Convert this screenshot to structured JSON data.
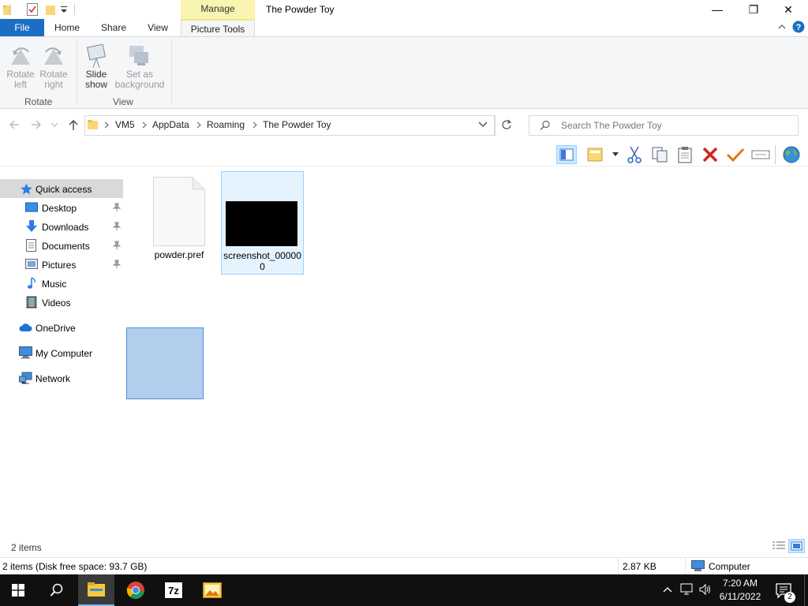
{
  "window": {
    "title": "The Powder Toy",
    "context_tab_group": "Manage",
    "controls": {
      "minimize": "—",
      "maximize": "❐",
      "close": "✕"
    }
  },
  "tabs": [
    "File",
    "Home",
    "Share",
    "View",
    "Picture Tools"
  ],
  "ribbon": {
    "rotate_left": [
      "Rotate",
      "left"
    ],
    "rotate_right": [
      "Rotate",
      "right"
    ],
    "slide_show": [
      "Slide",
      "show"
    ],
    "set_bg": [
      "Set as",
      "background"
    ],
    "group_rotate": "Rotate",
    "group_view": "View"
  },
  "address": {
    "crumbs": [
      "VM5",
      "AppData",
      "Roaming",
      "The Powder Toy"
    ],
    "search_placeholder": "Search The Powder Toy"
  },
  "nav": {
    "quick_access": "Quick access",
    "items": [
      "Desktop",
      "Downloads",
      "Documents",
      "Pictures",
      "Music",
      "Videos"
    ],
    "onedrive": "OneDrive",
    "my_computer": "My Computer",
    "network": "Network"
  },
  "files": [
    {
      "name": "powder.pref",
      "type": "file"
    },
    {
      "name": "screenshot_00000",
      "name2": "0",
      "type": "image"
    }
  ],
  "status": {
    "items": "2 items",
    "disk": "2 items (Disk free space: 93.7 GB)",
    "size": "2.87 KB",
    "location": "Computer"
  },
  "taskbar": {
    "time": "7:20 AM",
    "date": "6/11/2022",
    "notifications": "2",
    "apps": [
      "file-explorer",
      "chrome",
      "7zip",
      "image-viewer"
    ]
  },
  "colors": {
    "file_tab": "#1a6fc4",
    "manage_band": "#f9f5b0",
    "selection": "#cce8ff",
    "drag_rect": "#a9c9ec"
  }
}
